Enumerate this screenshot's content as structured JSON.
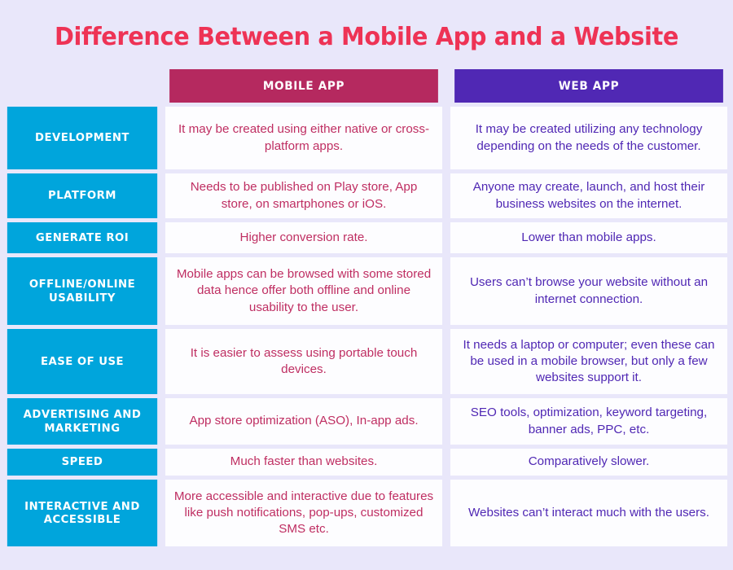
{
  "title": "Difference Between a Mobile App and a Website",
  "colors": {
    "background": "#e9e7fa",
    "title": "#ee3355",
    "label_cell": "#00a5dc",
    "mobile_header": "#b5295f",
    "web_header": "#5028b4",
    "mobile_text": "#bf2e62",
    "web_text": "#5028b4",
    "cell_background": "#fdfdff"
  },
  "headers": {
    "label_column": "",
    "mobile": "MOBILE APP",
    "web": "WEB APP"
  },
  "rows": [
    {
      "label": "DEVELOPMENT",
      "mobile": "It may be created using either native or cross-platform apps.",
      "web": "It may be created utilizing any technology depending on the needs of the customer."
    },
    {
      "label": "PLATFORM",
      "mobile": "Needs to be published on Play store, App store, on smartphones or iOS.",
      "web": "Anyone may create, launch, and host their business websites on the internet."
    },
    {
      "label": "GENERATE ROI",
      "mobile": "Higher conversion rate.",
      "web": "Lower than mobile apps."
    },
    {
      "label": "OFFLINE/ONLINE USABILITY",
      "mobile": "Mobile apps can be browsed with some stored data hence offer both offline and online usability to the user.",
      "web": "Users can’t browse your website without an internet connection."
    },
    {
      "label": "EASE OF USE",
      "mobile": "It is easier to assess using portable touch devices.",
      "web": "It needs a laptop or computer; even these can be used in a mobile browser, but only a few websites support it."
    },
    {
      "label": "ADVERTISING AND MARKETING",
      "mobile": "App store optimization (ASO), In-app ads.",
      "web": "SEO tools, optimization, keyword targeting, banner ads, PPC, etc."
    },
    {
      "label": "SPEED",
      "mobile": "Much faster than websites.",
      "web": "Comparatively slower."
    },
    {
      "label": "INTERACTIVE AND ACCESSIBLE",
      "mobile": "More accessible and interactive due to features like push notifications, pop-ups, customized SMS etc.",
      "web": "Websites can’t interact much with the users."
    }
  ]
}
